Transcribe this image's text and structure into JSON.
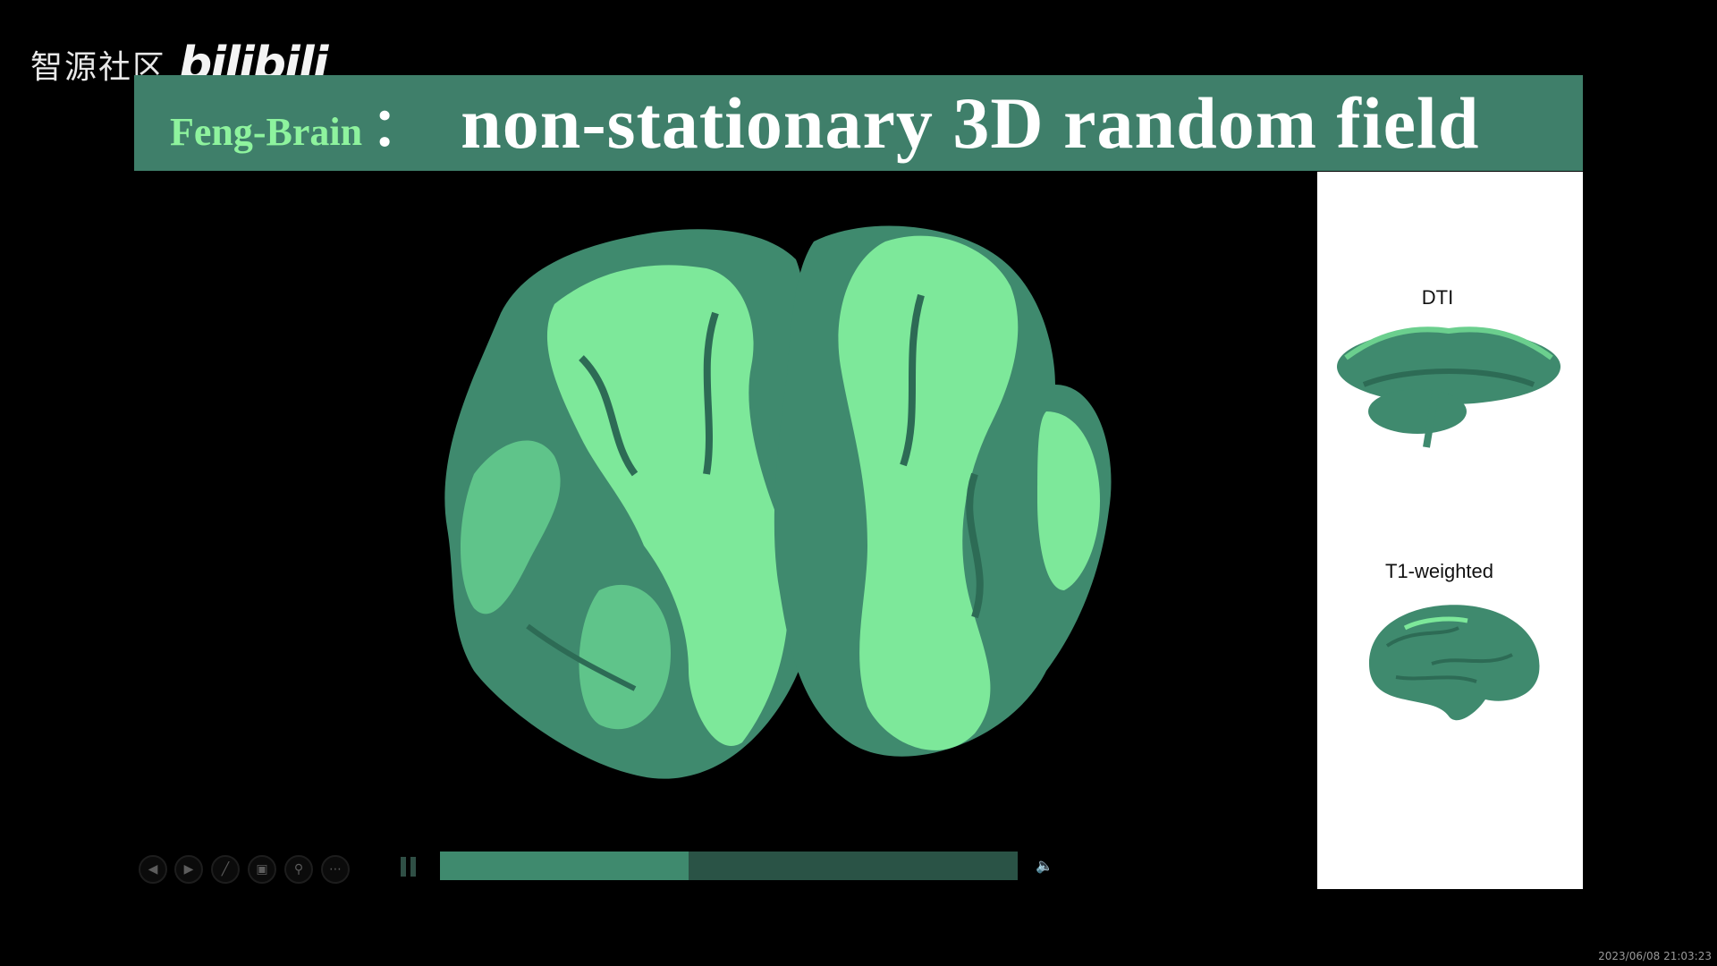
{
  "watermark": {
    "community": "智源社区",
    "logo": "bilibili"
  },
  "slide": {
    "title_prefix": "Feng-Brain",
    "title_colon": "：",
    "title_main": "non-stationary 3D random field"
  },
  "side_panel": {
    "items": [
      {
        "label": "DTI",
        "icon": "dti-tractography-image"
      },
      {
        "label": "T1-weighted",
        "icon": "t1-brain-image"
      }
    ]
  },
  "player": {
    "buttons": [
      "previous-icon",
      "next-icon",
      "pen-icon",
      "slides-icon",
      "zoom-icon",
      "more-icon"
    ],
    "progress_fraction": 0.43
  },
  "timestamp": "2023/06/08 21:03:23",
  "colors": {
    "title_bar": "#3f7f6a",
    "accent_green": "#8ef39e",
    "brain_light": "#7de89a",
    "brain_dark": "#3f8a6e"
  }
}
